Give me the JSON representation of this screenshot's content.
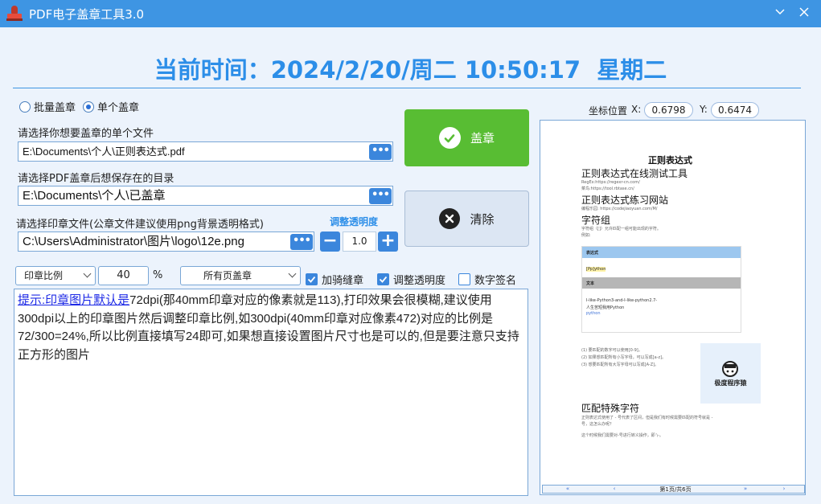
{
  "window": {
    "title": "PDF电子盖章工具3.0"
  },
  "clock": {
    "text": "当前时间：2024/2/20/周二 10:50:17  星期二"
  },
  "mode": {
    "batch_label": "批量盖章",
    "single_label": "单个盖章",
    "selected": "single"
  },
  "file_select": {
    "label": "请选择你想要盖章的单个文件",
    "value": "E:\\Documents\\个人\\正则表达式.pdf"
  },
  "save_dir": {
    "label": "请选择PDF盖章后想保存在的目录",
    "value": "E:\\Documents\\个人\\已盖章"
  },
  "seal_file": {
    "label": "请选择印章文件(公章文件建议使用png背景透明格式)",
    "value": "C:\\Users\\Administrator\\图片\\logo\\12e.png"
  },
  "opacity": {
    "title": "调整透明度",
    "value": "1.0",
    "minus": "−",
    "plus": "+"
  },
  "actions": {
    "stamp_label": "盖章",
    "clear_label": "清除"
  },
  "options": {
    "ratio_combo": "印章比例",
    "ratio_value": "40",
    "percent": "%",
    "page_combo": "所有页盖章",
    "seam_label": "加骑缝章",
    "seam_checked": true,
    "opacity_label": "调整透明度",
    "opacity_checked": true,
    "digital_label": "数字签名",
    "digital_checked": false
  },
  "info": {
    "link_text": "提示:印章图片默认是",
    "body": "72dpi(那40mm印章对应的像素就是113),打印效果会很模糊,建议使用300dpi以上的印章图片然后调整印章比例,如300dpi(40mm印章对应像素472)对应的比例是72/300=24%,所以比例直接填写24即可,如果想直接设置图片尺寸也是可以的,但是要注意只支持正方形的图片"
  },
  "coords": {
    "label": "坐标位置",
    "x_label": "X:",
    "x_value": "0.6798",
    "y_label": "Y:",
    "y_value": "0.6474"
  },
  "preview": {
    "doc_title": "正则表达式",
    "h1": "正则表达式在线测试工具",
    "h1_note1": "RegEx:https://regexr-cn.com/",
    "h1_note2": "菜鸟:https://tool.rbtase.cn/",
    "h2": "正则表达式练习网站",
    "h2_note": "编程乐园: https://codejiaoyuan.com/M/",
    "h3": "字符组",
    "h3_note1": "字符组（[]）允许匹配一组可能出现的字符。",
    "h3_note2": "例如:",
    "card_head1": "表达式",
    "card_expr": "[Pp]ython",
    "card_head2": "文本",
    "card_text1": "I-like-Python3-and-I-like-python2.7-",
    "card_text2": "人生苦短我用Python",
    "card_text3": "python",
    "list1": "(1) 要匹配的数字可以使用[0-9]。",
    "list2": "(2) 如果想匹配所有小写字母，可以写成[a-z]。",
    "list3": "(3) 想要匹配所有大写字母可以写成[A-Z]。",
    "seal_text": "极度程序猿",
    "h4": "匹配特殊字符",
    "h4_note1": "正则表达式使用了 - 号代表了区间，但是我们有时候需要匹配的符号就是 - ",
    "h4_note2": "号，这怎么办呢？",
    "h4_note3": "这个时候我们需要对-号进行转义操作，即 \\-。",
    "pager_text": "第1页/共6页",
    "pager_prev": "‹",
    "pager_first": "«",
    "pager_next": "»",
    "pager_last": "›"
  },
  "colors": {
    "titlebar": "#3e95e3",
    "accent": "#2c8ee8",
    "stamp_green": "#58bd33"
  }
}
